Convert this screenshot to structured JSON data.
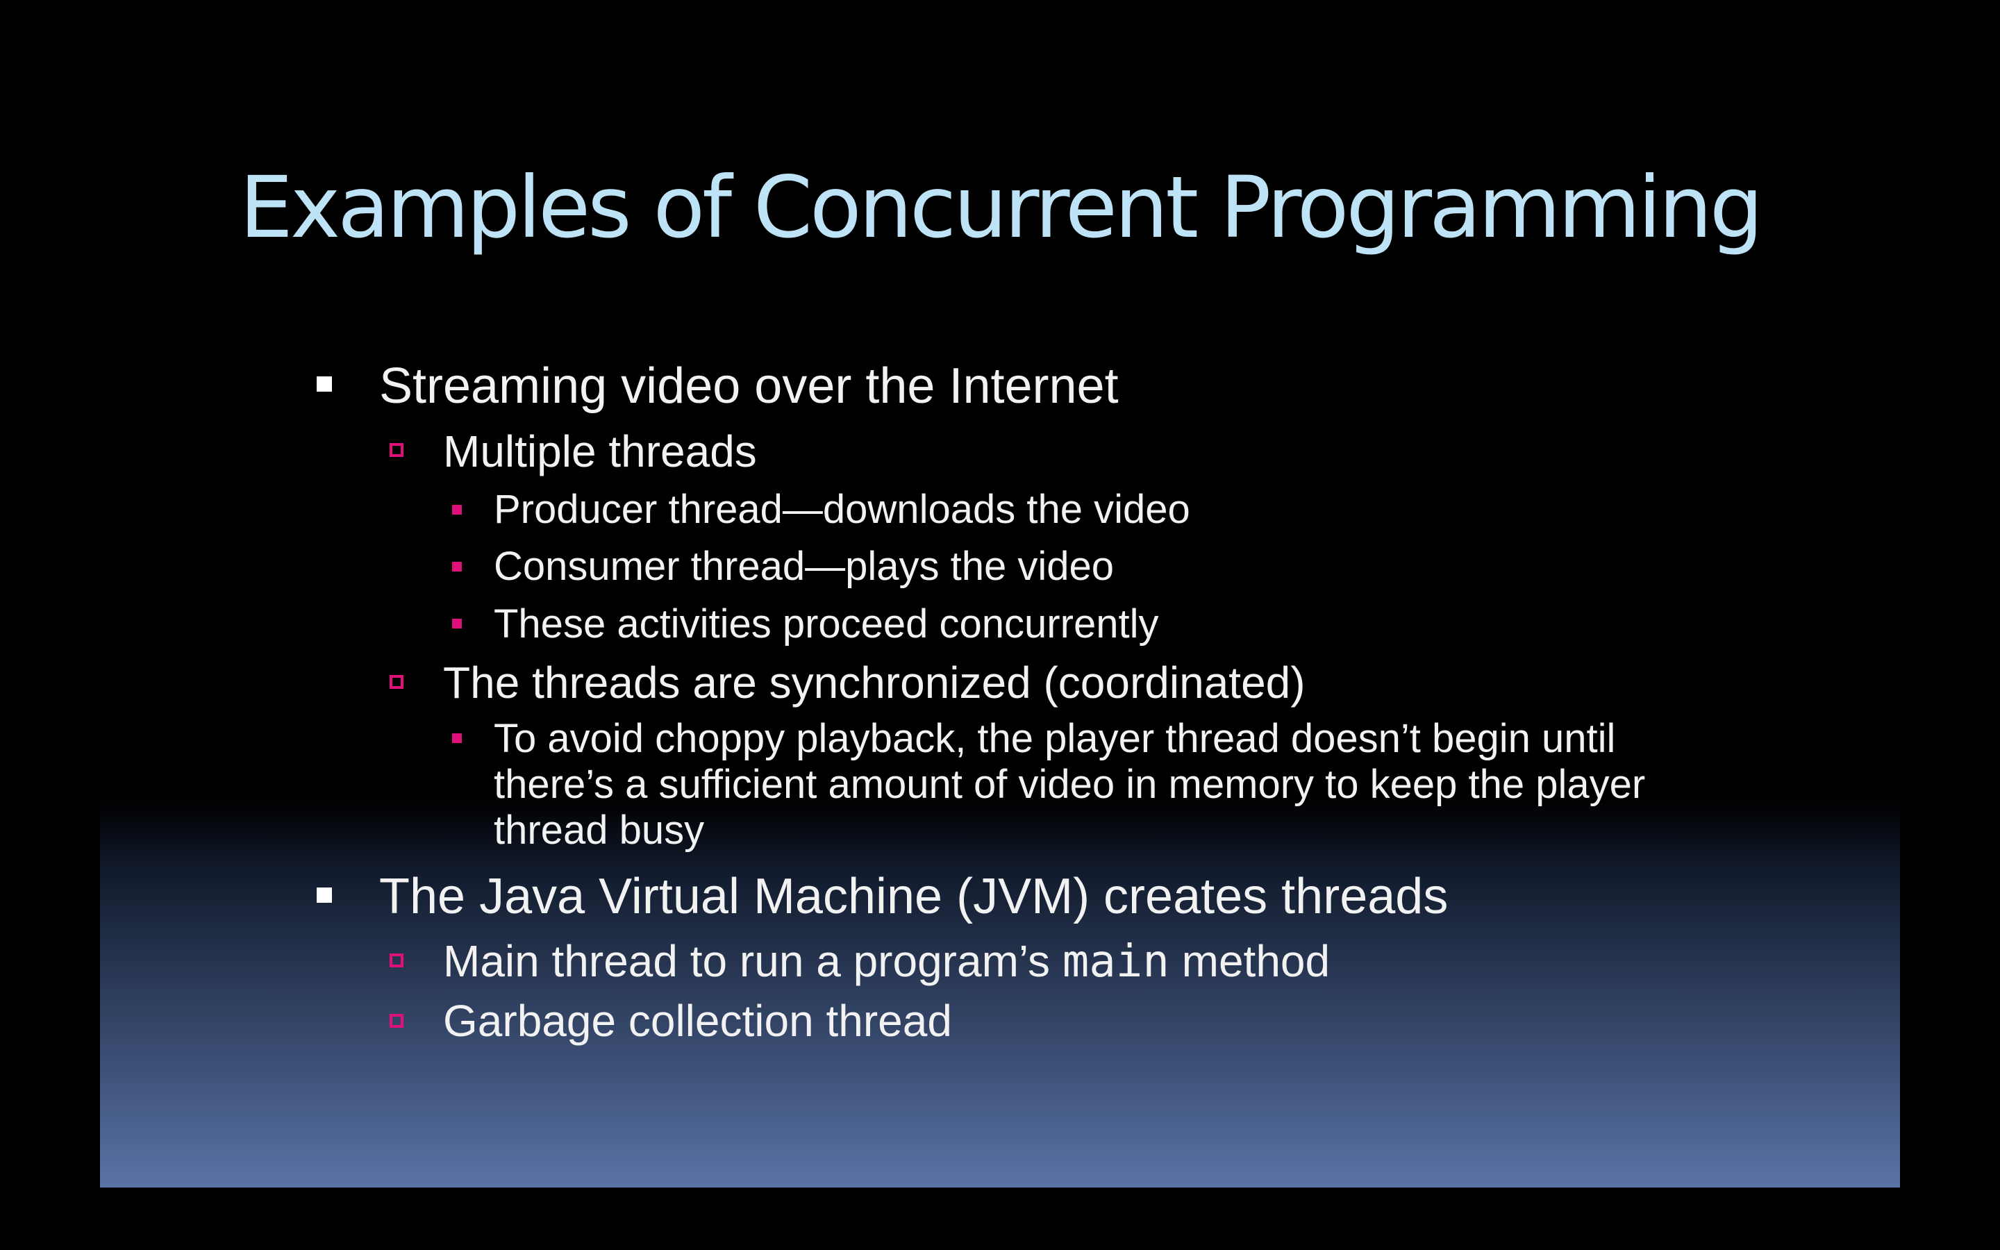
{
  "slide": {
    "title": "Examples of Concurrent Programming",
    "bullets": {
      "b1": "Streaming video over the Internet",
      "b1_1": "Multiple threads",
      "b1_1_1": "Producer thread—downloads the video",
      "b1_1_2": "Consumer thread—plays the video",
      "b1_1_3": "These activities proceed concurrently",
      "b1_2": "The threads are synchronized (coordinated)",
      "b1_2_1_line1": "To avoid choppy playback, the player thread doesn’t begin until",
      "b1_2_1_line2": "there’s a sufficient amount of video in memory to keep the player",
      "b1_2_1_line3": "thread busy",
      "b2": "The Java Virtual Machine (JVM) creates threads",
      "b2_1_pre": "Main thread to run a program’s ",
      "b2_1_code": "main",
      "b2_1_post": " method",
      "b2_2": "Garbage collection thread"
    }
  },
  "colors": {
    "background": "#000000",
    "title": "#bfe3f6",
    "text": "#f2f2f2",
    "accent_marker": "#e0107a",
    "gradient_bottom": "#5a73a7"
  }
}
